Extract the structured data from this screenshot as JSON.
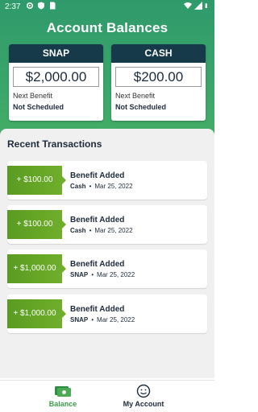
{
  "status_bar": {
    "time": "2:37"
  },
  "page_title": "Account Balances",
  "balances": [
    {
      "program": "SNAP",
      "amount": "$2,000.00",
      "next_label": "Next Benefit",
      "next_value": "Not Scheduled"
    },
    {
      "program": "CASH",
      "amount": "$200.00",
      "next_label": "Next Benefit",
      "next_value": "Not Scheduled"
    }
  ],
  "transactions_title": "Recent Transactions",
  "transactions": [
    {
      "amount": "+ $100.00",
      "title": "Benefit Added",
      "program": "Cash",
      "dot": "•",
      "date": "Mar 25, 2022"
    },
    {
      "amount": "+ $100.00",
      "title": "Benefit Added",
      "program": "Cash",
      "dot": "•",
      "date": "Mar 25, 2022"
    },
    {
      "amount": "+ $1,000.00",
      "title": "Benefit Added",
      "program": "SNAP",
      "dot": "•",
      "date": "Mar 25, 2022"
    },
    {
      "amount": "+ $1,000.00",
      "title": "Benefit Added",
      "program": "SNAP",
      "dot": "•",
      "date": "Mar 25, 2022"
    }
  ],
  "bottom_nav": [
    {
      "label": "Balance",
      "icon": "wallet-icon",
      "active": true
    },
    {
      "label": "My Account",
      "icon": "user-face-icon",
      "active": false
    }
  ],
  "colors": {
    "header_gradient_top": "#2f9a6b",
    "header_gradient_bottom": "#49b064",
    "card_header": "#173a4a",
    "amount_tag": "#6fae2b",
    "active_nav": "#3e9a4a"
  }
}
